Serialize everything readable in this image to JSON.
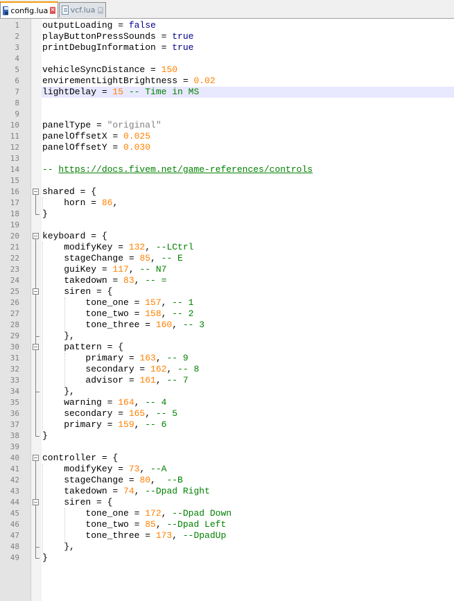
{
  "tabs": [
    {
      "label": "config.lua",
      "active": true,
      "icon": "floppy-disk-icon"
    },
    {
      "label": "vcf.lua",
      "active": false,
      "icon": "document-icon"
    }
  ],
  "current_line": 7,
  "lines": [
    [
      {
        "t": "outputLoading = "
      },
      {
        "t": "false",
        "c": "kw"
      }
    ],
    [
      {
        "t": "playButtonPressSounds = "
      },
      {
        "t": "true",
        "c": "kw"
      }
    ],
    [
      {
        "t": "printDebugInformation = "
      },
      {
        "t": "true",
        "c": "kw"
      }
    ],
    [],
    [
      {
        "t": "vehicleSyncDistance = "
      },
      {
        "t": "150",
        "c": "num"
      }
    ],
    [
      {
        "t": "envirementLightBrightness = "
      },
      {
        "t": "0.02",
        "c": "num"
      }
    ],
    [
      {
        "t": "lightDelay = "
      },
      {
        "t": "15",
        "c": "num"
      },
      {
        "t": " -- Time in MS",
        "c": "cmt"
      }
    ],
    [],
    [],
    [
      {
        "t": "panelType = "
      },
      {
        "t": "\"original\"",
        "c": "str"
      }
    ],
    [
      {
        "t": "panelOffsetX = "
      },
      {
        "t": "0.025",
        "c": "num"
      }
    ],
    [
      {
        "t": "panelOffsetY = "
      },
      {
        "t": "0.030",
        "c": "num"
      }
    ],
    [],
    [
      {
        "t": "-- ",
        "c": "cmt"
      },
      {
        "t": "https://docs.fivem.net/game-references/controls",
        "c": "link"
      }
    ],
    [],
    [
      {
        "t": "shared = {"
      }
    ],
    [
      {
        "t": "    horn = "
      },
      {
        "t": "86",
        "c": "num"
      },
      {
        "t": ","
      }
    ],
    [
      {
        "t": "}"
      }
    ],
    [],
    [
      {
        "t": "keyboard = {"
      }
    ],
    [
      {
        "t": "    modifyKey = "
      },
      {
        "t": "132",
        "c": "num"
      },
      {
        "t": ", "
      },
      {
        "t": "--LCtrl",
        "c": "cmt"
      }
    ],
    [
      {
        "t": "    stageChange = "
      },
      {
        "t": "85",
        "c": "num"
      },
      {
        "t": ", "
      },
      {
        "t": "-- E",
        "c": "cmt"
      }
    ],
    [
      {
        "t": "    guiKey = "
      },
      {
        "t": "117",
        "c": "num"
      },
      {
        "t": ", "
      },
      {
        "t": "-- N7",
        "c": "cmt"
      }
    ],
    [
      {
        "t": "    takedown = "
      },
      {
        "t": "83",
        "c": "num"
      },
      {
        "t": ", "
      },
      {
        "t": "-- =",
        "c": "cmt"
      }
    ],
    [
      {
        "t": "    siren = {"
      }
    ],
    [
      {
        "t": "        tone_one = "
      },
      {
        "t": "157",
        "c": "num"
      },
      {
        "t": ", "
      },
      {
        "t": "-- 1",
        "c": "cmt"
      }
    ],
    [
      {
        "t": "        tone_two = "
      },
      {
        "t": "158",
        "c": "num"
      },
      {
        "t": ", "
      },
      {
        "t": "-- 2",
        "c": "cmt"
      }
    ],
    [
      {
        "t": "        tone_three = "
      },
      {
        "t": "160",
        "c": "num"
      },
      {
        "t": ", "
      },
      {
        "t": "-- 3",
        "c": "cmt"
      }
    ],
    [
      {
        "t": "    },"
      }
    ],
    [
      {
        "t": "    pattern = {"
      }
    ],
    [
      {
        "t": "        primary = "
      },
      {
        "t": "163",
        "c": "num"
      },
      {
        "t": ", "
      },
      {
        "t": "-- 9",
        "c": "cmt"
      }
    ],
    [
      {
        "t": "        secondary = "
      },
      {
        "t": "162",
        "c": "num"
      },
      {
        "t": ", "
      },
      {
        "t": "-- 8",
        "c": "cmt"
      }
    ],
    [
      {
        "t": "        advisor = "
      },
      {
        "t": "161",
        "c": "num"
      },
      {
        "t": ", "
      },
      {
        "t": "-- 7",
        "c": "cmt"
      }
    ],
    [
      {
        "t": "    },"
      }
    ],
    [
      {
        "t": "    warning = "
      },
      {
        "t": "164",
        "c": "num"
      },
      {
        "t": ", "
      },
      {
        "t": "-- 4",
        "c": "cmt"
      }
    ],
    [
      {
        "t": "    secondary = "
      },
      {
        "t": "165",
        "c": "num"
      },
      {
        "t": ", "
      },
      {
        "t": "-- 5",
        "c": "cmt"
      }
    ],
    [
      {
        "t": "    primary = "
      },
      {
        "t": "159",
        "c": "num"
      },
      {
        "t": ", "
      },
      {
        "t": "-- 6",
        "c": "cmt"
      }
    ],
    [
      {
        "t": "}"
      }
    ],
    [],
    [
      {
        "t": "controller = {"
      }
    ],
    [
      {
        "t": "    modifyKey = "
      },
      {
        "t": "73",
        "c": "num"
      },
      {
        "t": ", "
      },
      {
        "t": "--A",
        "c": "cmt"
      }
    ],
    [
      {
        "t": "    stageChange = "
      },
      {
        "t": "80",
        "c": "num"
      },
      {
        "t": ",  "
      },
      {
        "t": "--B",
        "c": "cmt"
      }
    ],
    [
      {
        "t": "    takedown = "
      },
      {
        "t": "74",
        "c": "num"
      },
      {
        "t": ", "
      },
      {
        "t": "--Dpad Right",
        "c": "cmt"
      }
    ],
    [
      {
        "t": "    siren = {"
      }
    ],
    [
      {
        "t": "        tone_one = "
      },
      {
        "t": "172",
        "c": "num"
      },
      {
        "t": ", "
      },
      {
        "t": "--Dpad Down",
        "c": "cmt"
      }
    ],
    [
      {
        "t": "        tone_two = "
      },
      {
        "t": "85",
        "c": "num"
      },
      {
        "t": ", "
      },
      {
        "t": "--Dpad Left",
        "c": "cmt"
      }
    ],
    [
      {
        "t": "        tone_three = "
      },
      {
        "t": "173",
        "c": "num"
      },
      {
        "t": ", "
      },
      {
        "t": "--DpadUp",
        "c": "cmt"
      }
    ],
    [
      {
        "t": "    },"
      }
    ],
    [
      {
        "t": "}"
      }
    ]
  ],
  "colors": {
    "keyword": "#00008b",
    "number": "#ff8000",
    "string": "#808080",
    "comment": "#008000",
    "current_line_bg": "#e8e8ff",
    "active_tab_accent": "#f39c12"
  }
}
